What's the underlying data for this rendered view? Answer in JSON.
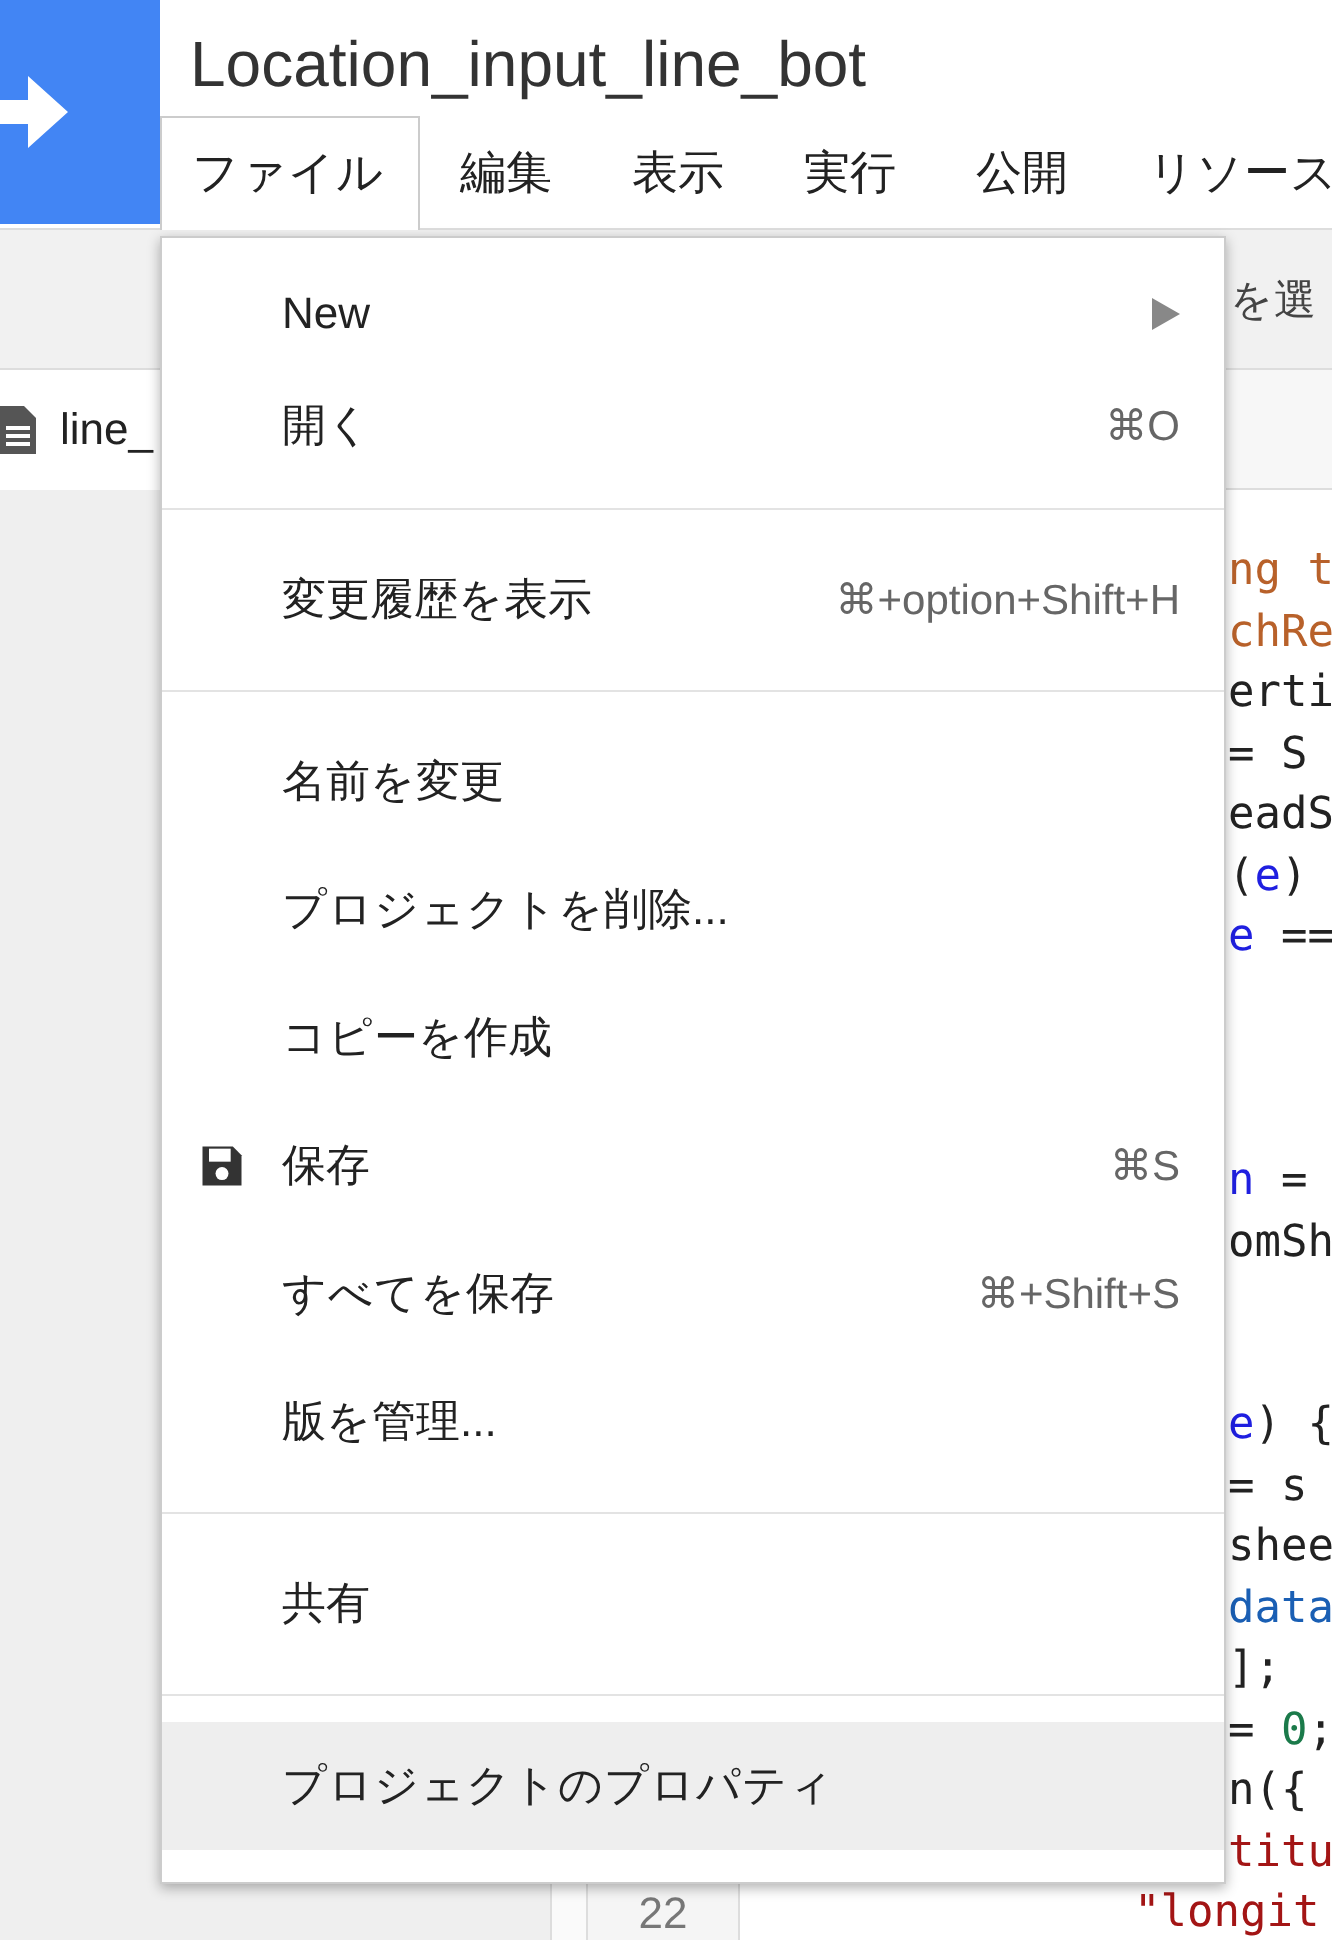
{
  "app": {
    "title": "Location_input_line_bot"
  },
  "menu_bar": [
    {
      "label": "ファイル",
      "selected": true
    },
    {
      "label": "編集",
      "selected": false
    },
    {
      "label": "表示",
      "selected": false
    },
    {
      "label": "実行",
      "selected": false
    },
    {
      "label": "公開",
      "selected": false
    },
    {
      "label": "リソース",
      "selected": false
    }
  ],
  "toolbar": {
    "hint": "を選"
  },
  "file_tab": {
    "label": "line_"
  },
  "gutter": {
    "line_number": "22"
  },
  "code_lines": [
    {
      "segments": [
        {
          "text": "ng t",
          "color": "#b8612a"
        }
      ]
    },
    {
      "segments": [
        {
          "text": "chRe",
          "color": "#b8612a"
        }
      ]
    },
    {
      "segments": [
        {
          "text": "erti",
          "color": "#222222"
        }
      ]
    },
    {
      "segments": [
        {
          "text": "= S",
          "color": "#222222"
        }
      ]
    },
    {
      "segments": [
        {
          "text": "eadS",
          "color": "#222222"
        }
      ]
    },
    {
      "segments": [
        {
          "text": "(",
          "color": "#222222"
        },
        {
          "text": "e",
          "color": "#1f1fe0"
        },
        {
          "text": ")",
          "color": "#222222"
        }
      ]
    },
    {
      "segments": [
        {
          "text": "e",
          "color": "#1f1fe0"
        },
        {
          "text": " ==",
          "color": "#222222"
        }
      ]
    },
    {
      "blank": true
    },
    {
      "blank": true
    },
    {
      "blank": true
    },
    {
      "segments": [
        {
          "text": "n",
          "color": "#1f1fe0"
        },
        {
          "text": " =",
          "color": "#222222"
        }
      ]
    },
    {
      "segments": [
        {
          "text": "omSh",
          "color": "#222222"
        }
      ]
    },
    {
      "blank": true
    },
    {
      "blank": true
    },
    {
      "segments": [
        {
          "text": "e",
          "color": "#1f1fe0"
        },
        {
          "text": ") {",
          "color": "#222222"
        }
      ]
    },
    {
      "segments": [
        {
          "text": "= s",
          "color": "#222222"
        }
      ]
    },
    {
      "segments": [
        {
          "text": "shee",
          "color": "#222222"
        }
      ]
    },
    {
      "segments": [
        {
          "text": "data",
          "color": "#1a5fb4"
        }
      ]
    },
    {
      "segments": [
        {
          "text": "];",
          "color": "#222222"
        }
      ]
    },
    {
      "segments": [
        {
          "text": "= ",
          "color": "#222222"
        },
        {
          "text": "0",
          "color": "#1b7a4a"
        },
        {
          "text": ";",
          "color": "#222222"
        }
      ]
    },
    {
      "segments": [
        {
          "text": "n({",
          "color": "#222222"
        }
      ]
    },
    {
      "segments": [
        {
          "text": "titu",
          "color": "#a31515"
        }
      ]
    },
    {
      "segments": [
        {
          "text": "\"longit",
          "color": "#a31515"
        }
      ]
    }
  ],
  "file_menu": [
    {
      "kind": "item",
      "label": "New",
      "submenu": true,
      "selected": false
    },
    {
      "kind": "item",
      "label": "開く",
      "shortcut": "⌘O",
      "selected": false
    },
    {
      "kind": "divider"
    },
    {
      "kind": "item",
      "label": "変更履歴を表示",
      "shortcut": "⌘+option+Shift+H",
      "selected": false
    },
    {
      "kind": "divider"
    },
    {
      "kind": "item",
      "label": "名前を変更",
      "selected": false
    },
    {
      "kind": "item",
      "label": "プロジェクトを削除...",
      "selected": false
    },
    {
      "kind": "item",
      "label": "コピーを作成",
      "selected": false
    },
    {
      "kind": "iconitem",
      "label": "保存",
      "shortcut": "⌘S",
      "selected": false
    },
    {
      "kind": "item",
      "label": "すべてを保存",
      "shortcut": "⌘+Shift+S",
      "selected": false
    },
    {
      "kind": "item",
      "label": "版を管理...",
      "selected": false
    },
    {
      "kind": "divider"
    },
    {
      "kind": "item",
      "label": "共有",
      "selected": false
    },
    {
      "kind": "divider"
    },
    {
      "kind": "item",
      "label": "プロジェクトのプロパティ",
      "selected": true
    }
  ]
}
